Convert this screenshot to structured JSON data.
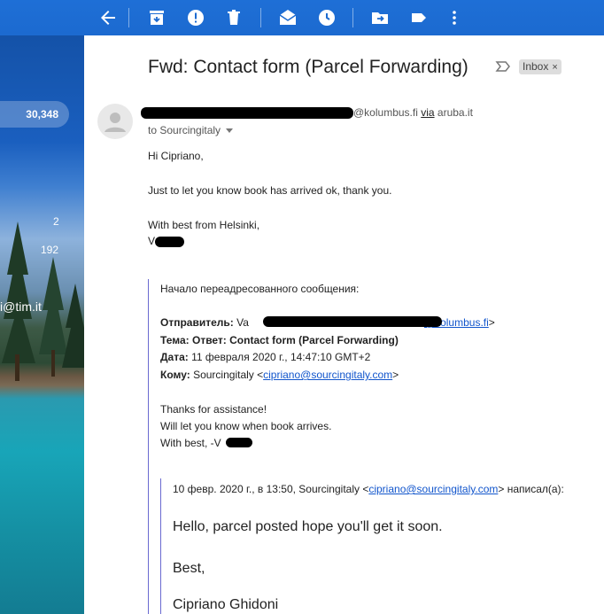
{
  "toolbar": {
    "icons": [
      "back-arrow-icon",
      "archive-icon",
      "report-spam-icon",
      "delete-icon",
      "mark-unread-icon",
      "snooze-icon",
      "move-to-icon",
      "label-icon",
      "more-vert-icon"
    ]
  },
  "sidebar": {
    "counter": "30,348",
    "count_a": "2",
    "count_b": "192",
    "email_fragment": "i@tim.it"
  },
  "message": {
    "subject": "Fwd: Contact form (Parcel Forwarding)",
    "badge": "Inbox",
    "badge_close": "×",
    "sender_domain": "@kolumbus.fi",
    "via_label": "via",
    "via_domain": "aruba.it",
    "to_line": "to Sourcingitaly",
    "greeting": "Hi Cipriano,",
    "line1": "Just to let you know book has arrived ok, thank you.",
    "signoff": "With best from Helsinki,",
    "sig_initial": "V"
  },
  "forwarded": {
    "header": "Начало переадресованного сообщения:",
    "from_label": "Отправитель:",
    "from_prefix": "Va",
    "from_email_tail": "@kolumbus.fi",
    "from_close": ">",
    "subject_label": "Тема:",
    "subject_value": "Ответ: Contact form (Parcel Forwarding)",
    "date_label": "Дата:",
    "date_value": "11 февраля 2020 г., 14:47:10 GMT+2",
    "to_label": "Кому:",
    "to_name": "Sourcingitaly <",
    "to_email": "cipriano@sourcingitaly.com",
    "to_close": ">",
    "body1": "Thanks for assistance!",
    "body2": "Will let you know when book arrives.",
    "body3": "With best, -V"
  },
  "nested": {
    "meta_prefix": "10 февр. 2020 г., в 13:50, Sourcingitaly <",
    "meta_email": "cipriano@sourcingitaly.com",
    "meta_suffix": "> написал(а):",
    "line1": "Hello, parcel posted hope you'll get it soon.",
    "line2": "Best,",
    "line3": "Cipriano Ghidoni"
  },
  "colors": {
    "toolbar": "#1c6ad0",
    "quote_bar": "#6a6ad0",
    "link": "#1155cc"
  }
}
